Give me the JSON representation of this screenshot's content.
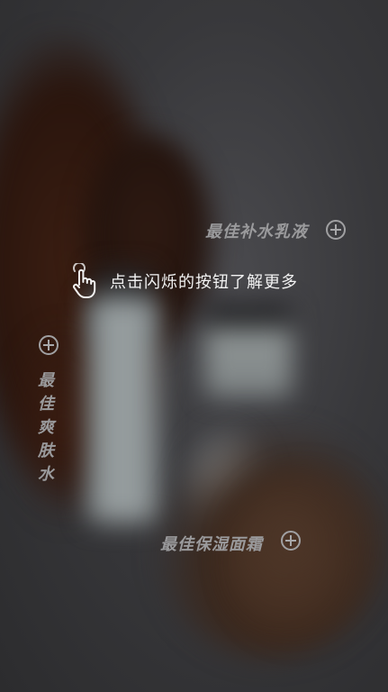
{
  "hint": {
    "text": "点击闪烁的按钮了解更多",
    "icon": "tap-hand-icon"
  },
  "hotspots": [
    {
      "label": "最佳补水乳液",
      "icon": "plus-icon"
    },
    {
      "label": "最佳爽肤水",
      "icon": "plus-icon"
    },
    {
      "label": "最佳保湿面霜",
      "icon": "plus-icon"
    }
  ],
  "colors": {
    "overlay_text": "#f2f2f2",
    "hotspot_text": "#9a9a9c"
  }
}
